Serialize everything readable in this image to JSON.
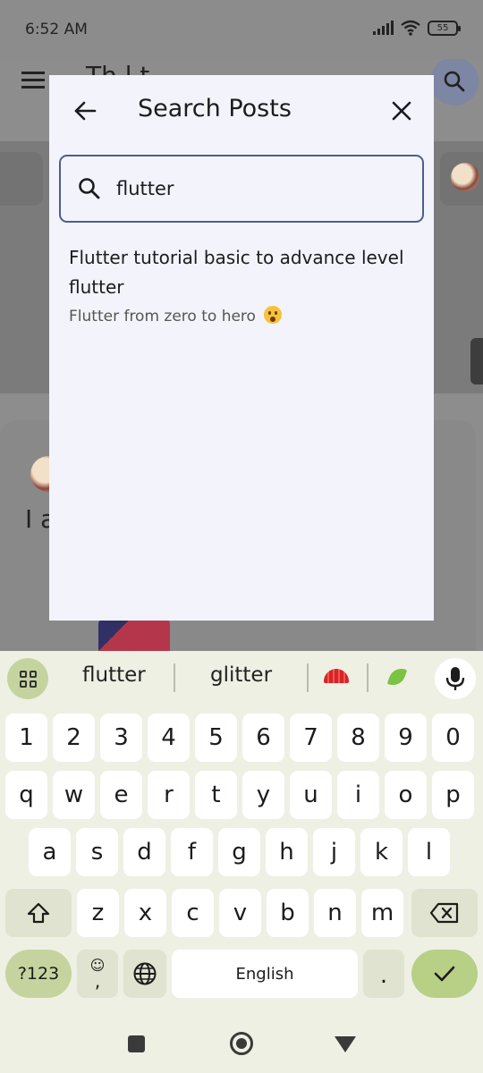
{
  "status_bar": {
    "time": "6:52 AM",
    "battery": "55",
    "icons": [
      "signal-icon",
      "wifi-icon",
      "battery-icon"
    ]
  },
  "background": {
    "title": "Th     l   t",
    "text": "I a"
  },
  "dialog": {
    "title": "Search Posts",
    "search_value": "flutter",
    "results": [
      {
        "title": "Flutter tutorial basic to advance level flutter",
        "subtitle": "Flutter from zero to hero"
      }
    ]
  },
  "keyboard": {
    "suggestions": [
      "flutter",
      "glitter"
    ],
    "number_row": [
      "1",
      "2",
      "3",
      "4",
      "5",
      "6",
      "7",
      "8",
      "9",
      "0"
    ],
    "row1": [
      "q",
      "w",
      "e",
      "r",
      "t",
      "y",
      "u",
      "i",
      "o",
      "p"
    ],
    "row2": [
      "a",
      "s",
      "d",
      "f",
      "g",
      "h",
      "j",
      "k",
      "l"
    ],
    "row3": [
      "z",
      "x",
      "c",
      "v",
      "b",
      "n",
      "m"
    ],
    "symbols_label": "?123",
    "comma_label": ",",
    "space_label": "English",
    "period_label": ".",
    "accent_color": "#c5d49e",
    "enter_color": "#b8cf86"
  },
  "colors": {
    "dialog_bg": "#f3f3fb",
    "search_border": "#4f5d8f",
    "keyboard_bg": "#eef0e4"
  }
}
